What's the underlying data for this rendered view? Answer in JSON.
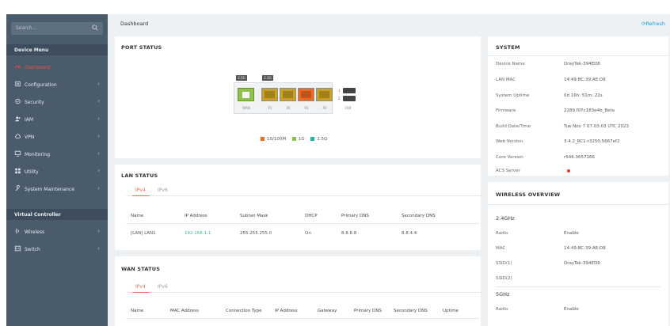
{
  "sidebar": {
    "search_placeholder": "Search...",
    "device_menu_header": "Device Menu",
    "device_items": [
      {
        "label": "Dashboard",
        "icon": "dashboard-icon",
        "active": true
      },
      {
        "label": "Configuration",
        "icon": "configuration-icon"
      },
      {
        "label": "Security",
        "icon": "shield-icon"
      },
      {
        "label": "IAM",
        "icon": "users-icon"
      },
      {
        "label": "VPN",
        "icon": "cloud-icon"
      },
      {
        "label": "Monitoring",
        "icon": "monitor-icon"
      },
      {
        "label": "Utility",
        "icon": "grid-icon"
      },
      {
        "label": "System Maintenance",
        "icon": "wrench-icon"
      }
    ],
    "controller_header": "Virtual Controller",
    "controller_items": [
      {
        "label": "Wireless",
        "icon": "wireless-icon"
      },
      {
        "label": "Switch",
        "icon": "switch-icon"
      }
    ]
  },
  "header": {
    "breadcrumb": "Dashboard",
    "refresh_label": "Refresh"
  },
  "port_status": {
    "title": "PORT STATUS",
    "badges": [
      "2.5G",
      "2.5G"
    ],
    "ports": [
      {
        "label": "WAN",
        "color": "#8fc441"
      },
      {
        "label": "P1",
        "color": "#c9a122"
      },
      {
        "label": "P2",
        "color": "#c9a122"
      },
      {
        "label": "P3",
        "color": "#f26a21"
      },
      {
        "label": "P4",
        "color": "#c9a122"
      }
    ],
    "usb_numbers": [
      "1",
      "2"
    ],
    "usb_label": "USB",
    "legend": [
      {
        "label": "10/100M",
        "color": "#f26a21"
      },
      {
        "label": "1G",
        "color": "#8fc441"
      },
      {
        "label": "2.5G",
        "color": "#1ab7a4"
      }
    ]
  },
  "lan_status": {
    "title": "LAN STATUS",
    "tabs": [
      "IPv4",
      "IPv6"
    ],
    "columns": [
      "Name",
      "IP Address",
      "Subnet Mask",
      "DHCP",
      "Primary DNS",
      "Secondary DNS"
    ],
    "rows": [
      [
        "[LAN] LAN1",
        "192.168.1.1",
        "255.255.255.0",
        "On",
        "8.8.8.8",
        "8.8.4.4"
      ]
    ]
  },
  "wan_status": {
    "title": "WAN STATUS",
    "tabs": [
      "IPv4",
      "IPv6"
    ],
    "columns": [
      "Name",
      "MAC Address",
      "Connection Type",
      "IP Address",
      "Gateway",
      "Primary DNS",
      "Secondary DNS",
      "Uptime"
    ]
  },
  "system": {
    "title": "SYSTEM",
    "rows": [
      {
        "key": "Device Name",
        "value": "DrayTek-394ED8"
      },
      {
        "key": "LAN MAC",
        "value": "14:49:BC:39:AE:D8"
      },
      {
        "key": "System Uptime",
        "value": "0d 16h: 51m: 22s"
      },
      {
        "key": "Firmware",
        "value": "2289.f07c183e4b_Beta"
      },
      {
        "key": "Build Date/Time",
        "value": "Tue Nov 7 07:03:03 UTC 2023"
      },
      {
        "key": "Web Version",
        "value": "3.4.2_RC1-r3250.5667ef2"
      },
      {
        "key": "Core Version",
        "value": "r546.3657166"
      },
      {
        "key": "ACS Server",
        "value": ""
      }
    ],
    "acs_status_color": "#e53935"
  },
  "wireless_overview": {
    "title": "WIRELESS OVERVIEW",
    "band_24": {
      "label": "2.4GHz",
      "rows": [
        {
          "key": "Radio",
          "value": "Enable"
        },
        {
          "key": "MAC",
          "value": "14:49:BC:39:AE:D8"
        },
        {
          "key": "SSID(1)",
          "value": "DrayTek-394ED8"
        },
        {
          "key": "SSID(2)",
          "value": ""
        }
      ]
    },
    "band_5": {
      "label": "5GHz",
      "rows": [
        {
          "key": "Radio",
          "value": "Enable"
        }
      ]
    }
  }
}
